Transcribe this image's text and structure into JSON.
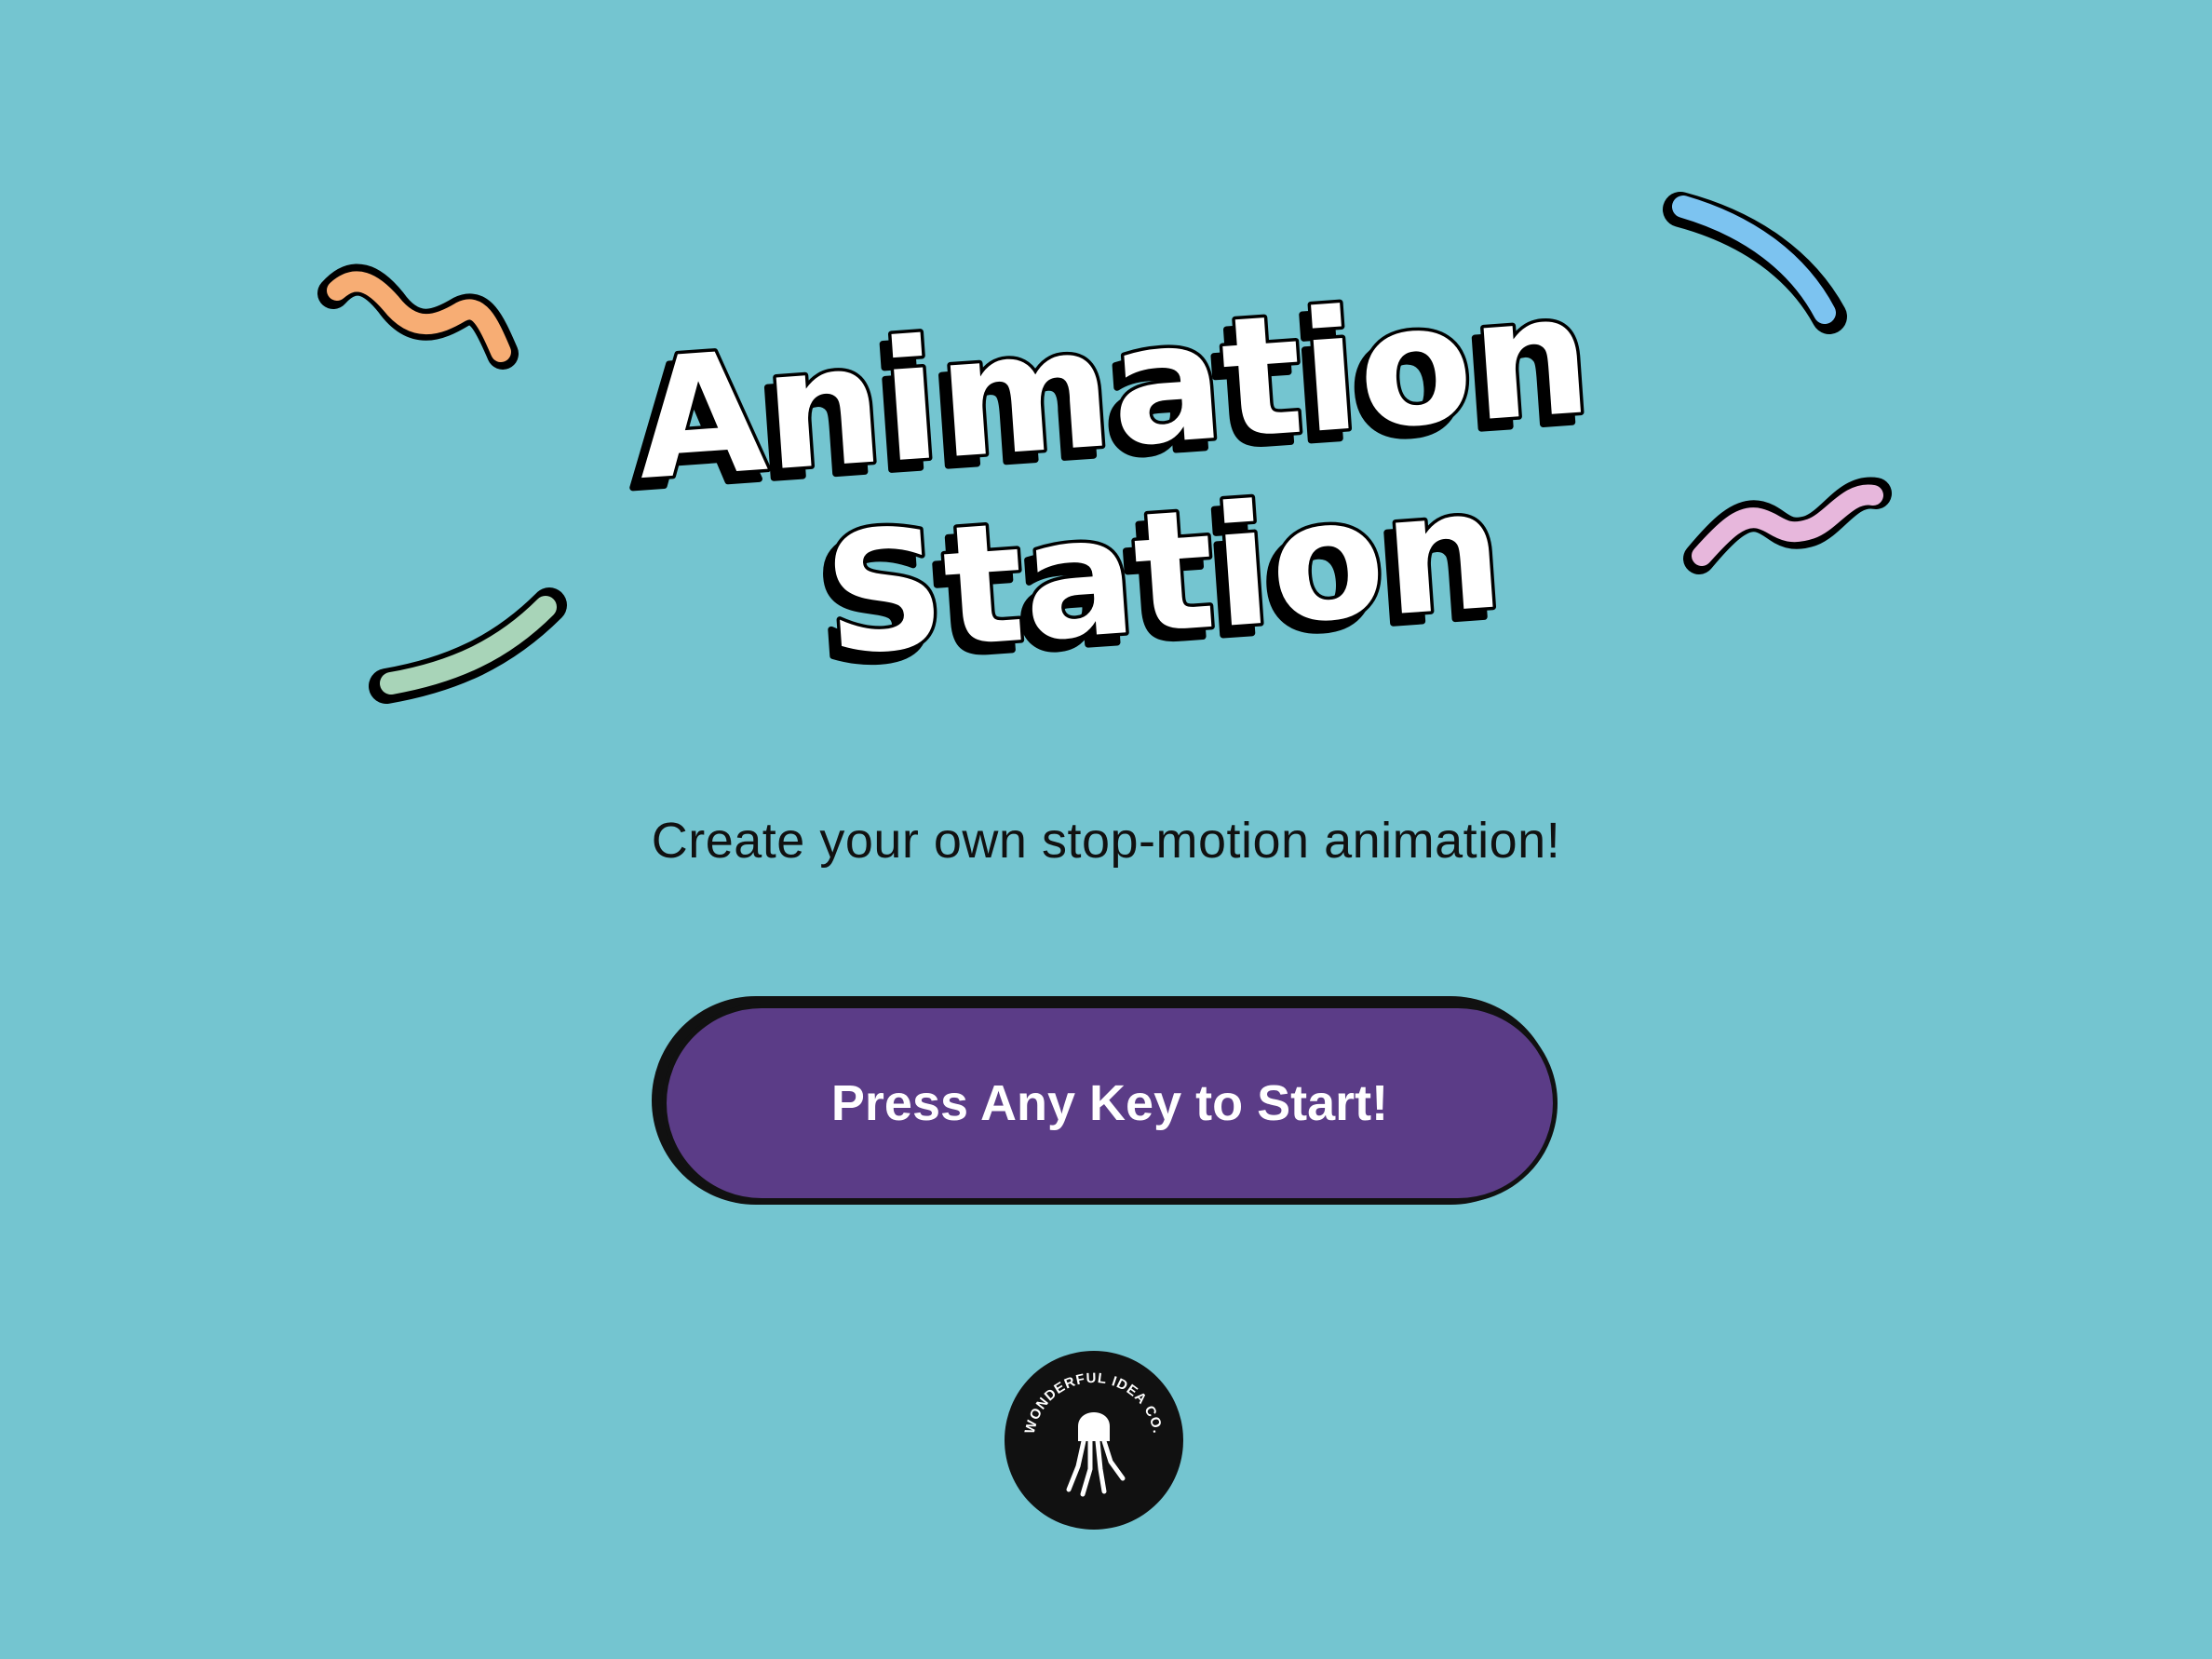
{
  "title": {
    "line1": "Animation",
    "line2": "Station"
  },
  "subtitle": "Create your own stop-motion animation!",
  "start_button": {
    "label": "Press Any Key to Start!"
  },
  "logo": {
    "text": "WONDERFUL IDEA CO.",
    "icon": "jellyfish-icon"
  },
  "colors": {
    "background": "#74c5d0",
    "button": "#5b3c87",
    "squiggle_orange": "#f7ad74",
    "squiggle_blue": "#7cc3f0",
    "squiggle_green": "#a8d4b8",
    "squiggle_pink": "#e7b7dc"
  }
}
